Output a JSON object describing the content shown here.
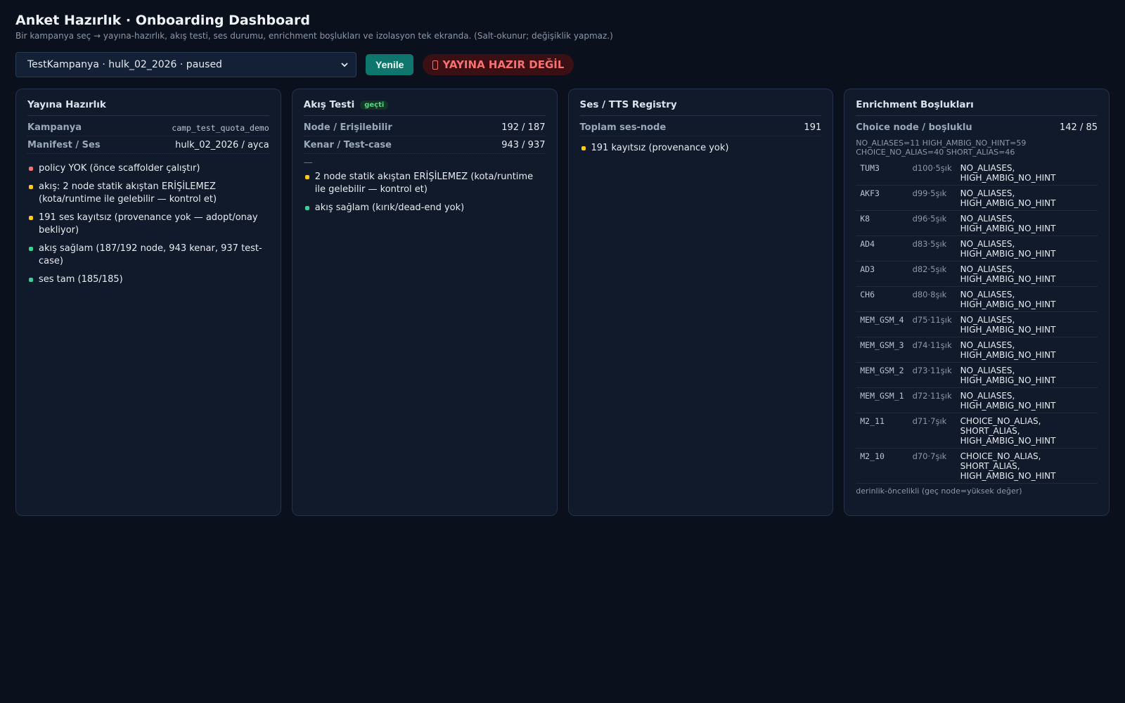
{
  "header": {
    "title": "Anket Hazırlık · Onboarding Dashboard",
    "subtitle": "Bir kampanya seç → yayına-hazırlık, akış testi, ses durumu, enrichment boşlukları ve izolasyon tek ekranda. (Salt-okunur; değişiklik yapmaz.)"
  },
  "toolbar": {
    "campaign_select_value": "TestKampanya · hulk_02_2026 · paused",
    "refresh_label": "Yenile",
    "status_badge": "YAYINA HAZIR DEĞİL"
  },
  "readiness": {
    "title": "Yayına Hazırlık",
    "campaign_key": "Kampanya",
    "campaign_value": "camp_test_quota_demo",
    "manifest_key": "Manifest / Ses",
    "manifest_value": "hulk_02_2026 / ayca",
    "items": [
      {
        "text": "policy YOK (önce scaffolder çalıştır)",
        "status": "red"
      },
      {
        "text": "akış: 2 node statik akıştan ERİŞİLEMEZ (kota/runtime ile gelebilir — kontrol et)",
        "status": "yellow"
      },
      {
        "text": "191 ses kayıtsız (provenance yok — adopt/onay bekliyor)",
        "status": "yellow"
      },
      {
        "text": "akış sağlam (187/192 node, 943 kenar, 937 test-case)",
        "status": "green"
      },
      {
        "text": "ses tam (185/185)",
        "status": "green"
      }
    ]
  },
  "flow_test": {
    "title": "Akış Testi",
    "badge": "geçti",
    "node_key": "Node / Erişilebilir",
    "node_value": "192 / 187",
    "edge_key": "Kenar / Test-case",
    "edge_value": "943 / 937",
    "dash": "—",
    "items": [
      {
        "text": "2 node statik akıştan ERİŞİLEMEZ (kota/runtime ile gelebilir — kontrol et)",
        "status": "yellow"
      },
      {
        "text": "akış sağlam (kırık/dead-end yok)",
        "status": "green"
      }
    ]
  },
  "tts": {
    "title": "Ses / TTS Registry",
    "total_key": "Toplam ses-node",
    "total_value": "191",
    "items": [
      {
        "text": "191 kayıtsız (provenance yok)",
        "status": "yellow"
      }
    ]
  },
  "enrichment": {
    "title": "Enrichment Boşlukları",
    "choice_key": "Choice node / boşluklu",
    "choice_value": "142 / 85",
    "summary": "NO_ALIASES=11 HIGH_AMBIG_NO_HINT=59 CHOICE_NO_ALIAS=40 SHORT_ALIAS=46",
    "rows": [
      {
        "id": "TUM3",
        "meta": "d100·5şık",
        "issues": "NO_ALIASES, HIGH_AMBIG_NO_HINT"
      },
      {
        "id": "AKF3",
        "meta": "d99·5şık",
        "issues": "NO_ALIASES, HIGH_AMBIG_NO_HINT"
      },
      {
        "id": "K8",
        "meta": "d96·5şık",
        "issues": "NO_ALIASES, HIGH_AMBIG_NO_HINT"
      },
      {
        "id": "AD4",
        "meta": "d83·5şık",
        "issues": "NO_ALIASES, HIGH_AMBIG_NO_HINT"
      },
      {
        "id": "AD3",
        "meta": "d82·5şık",
        "issues": "NO_ALIASES, HIGH_AMBIG_NO_HINT"
      },
      {
        "id": "CH6",
        "meta": "d80·8şık",
        "issues": "NO_ALIASES, HIGH_AMBIG_NO_HINT"
      },
      {
        "id": "MEM_GSM_4",
        "meta": "d75·11şık",
        "issues": "NO_ALIASES, HIGH_AMBIG_NO_HINT"
      },
      {
        "id": "MEM_GSM_3",
        "meta": "d74·11şık",
        "issues": "NO_ALIASES, HIGH_AMBIG_NO_HINT"
      },
      {
        "id": "MEM_GSM_2",
        "meta": "d73·11şık",
        "issues": "NO_ALIASES, HIGH_AMBIG_NO_HINT"
      },
      {
        "id": "MEM_GSM_1",
        "meta": "d72·11şık",
        "issues": "NO_ALIASES, HIGH_AMBIG_NO_HINT"
      },
      {
        "id": "M2_11",
        "meta": "d71·7şık",
        "issues": "CHOICE_NO_ALIAS, SHORT_ALIAS, HIGH_AMBIG_NO_HINT"
      },
      {
        "id": "M2_10",
        "meta": "d70·7şık",
        "issues": "CHOICE_NO_ALIAS, SHORT_ALIAS, HIGH_AMBIG_NO_HINT"
      }
    ],
    "footer": "derinlik-öncelikli (geç node=yüksek değer)"
  },
  "colors": {
    "background": "#0a101c",
    "card": "#111a2b",
    "accent": "#0f766e",
    "danger": "#f87171",
    "warning": "#facc15",
    "ok": "#34d399"
  }
}
